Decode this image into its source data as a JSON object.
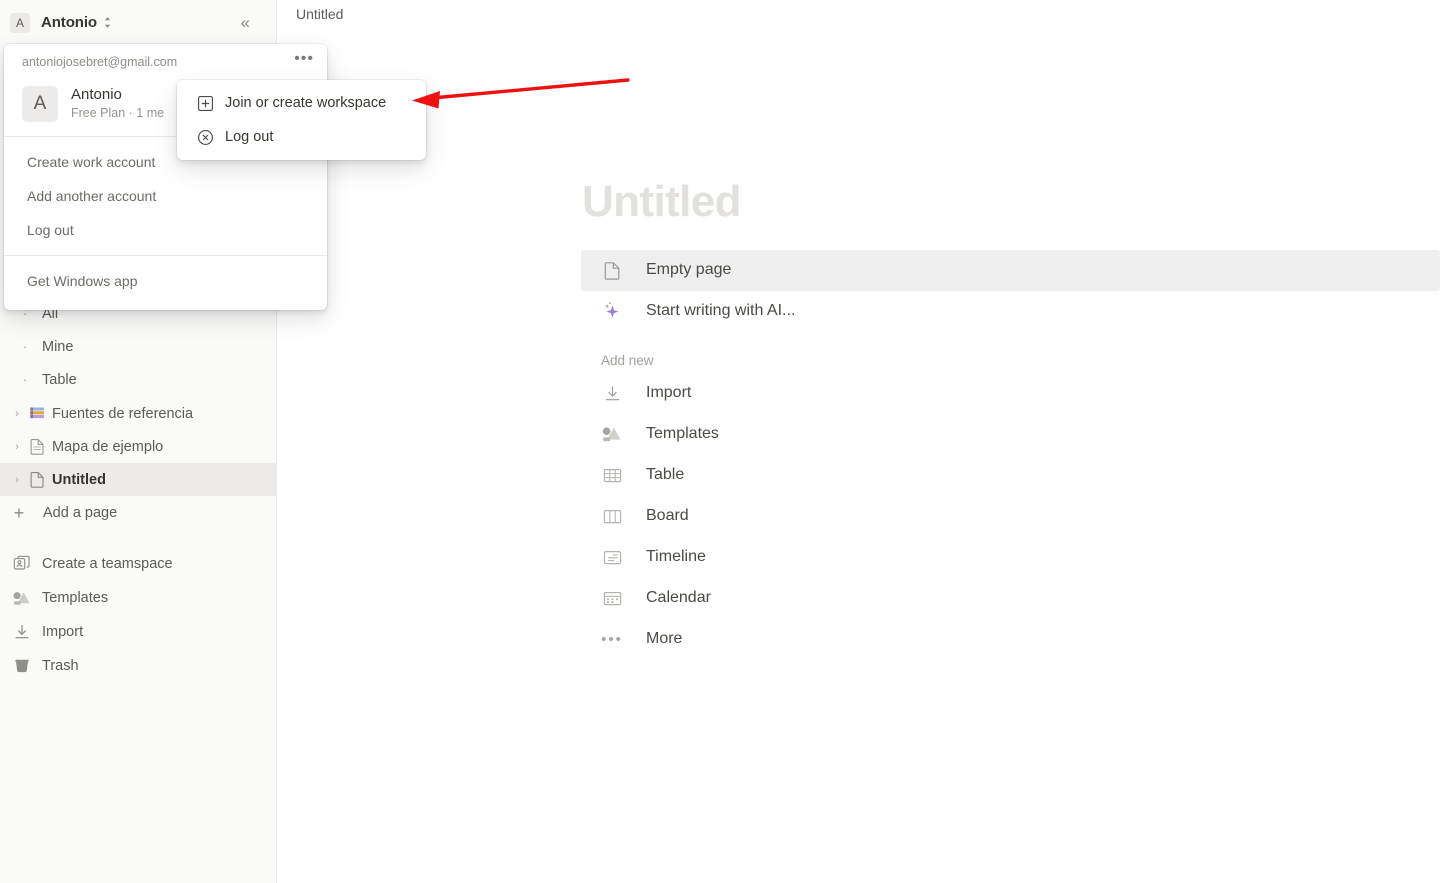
{
  "workspace": {
    "avatar_letter": "A",
    "name": "Antonio",
    "switch_icon": "chevron-up-down-icon",
    "collapse_icon": "collapse-sidebar-icon",
    "collapse_glyph": "«"
  },
  "breadcrumb": {
    "page": "Untitled"
  },
  "account_panel": {
    "email": "antoniojosebret@gmail.com",
    "more_icon": "ellipsis-icon",
    "more_glyph": "•••",
    "workspace": {
      "avatar_letter": "A",
      "name": "Antonio",
      "plan": "Free Plan · 1 me"
    },
    "items": [
      {
        "label": "Create work account"
      },
      {
        "label": "Add another account"
      },
      {
        "label": "Log out"
      }
    ],
    "footer_items": [
      {
        "label": "Get Windows app"
      }
    ]
  },
  "context_menu": {
    "items": [
      {
        "label": "Join or create workspace",
        "icon": "plus-square-icon"
      },
      {
        "label": "Log out",
        "icon": "x-circle-icon"
      }
    ]
  },
  "annotation": {
    "arrow_color": "#ee1111",
    "arrow_name": "red-pointer-arrow"
  },
  "sidebar": {
    "tree_items": [
      {
        "label": "All",
        "kind": "bullet",
        "icon": "bullet-dot-icon",
        "selected": false
      },
      {
        "label": "Mine",
        "kind": "bullet",
        "icon": "bullet-dot-icon",
        "selected": false
      },
      {
        "label": "Table",
        "kind": "bullet",
        "icon": "bullet-dot-icon",
        "selected": false
      }
    ],
    "page_items": [
      {
        "label": "Fuentes de referencia",
        "icon": "colored-books-emoji-icon",
        "selected": false
      },
      {
        "label": "Mapa de ejemplo",
        "icon": "page-icon",
        "selected": false
      },
      {
        "label": "Untitled",
        "icon": "page-icon",
        "selected": true
      }
    ],
    "add_page": {
      "label": "Add a page",
      "icon": "plus-icon"
    },
    "bottom_items": [
      {
        "label": "Create a teamspace",
        "icon": "teamspace-icon"
      },
      {
        "label": "Templates",
        "icon": "templates-icon"
      },
      {
        "label": "Import",
        "icon": "import-icon"
      },
      {
        "label": "Trash",
        "icon": "trash-icon"
      }
    ]
  },
  "main": {
    "title": "Untitled",
    "quick_options": [
      {
        "label": "Empty page",
        "icon": "page-icon",
        "highlighted": true
      },
      {
        "label": "Start writing with AI...",
        "icon": "ai-sparkle-icon",
        "highlighted": false
      }
    ],
    "add_new_label": "Add new",
    "add_new_items": [
      {
        "label": "Import",
        "icon": "import-icon"
      },
      {
        "label": "Templates",
        "icon": "templates-icon"
      },
      {
        "label": "Table",
        "icon": "table-icon"
      },
      {
        "label": "Board",
        "icon": "board-icon"
      },
      {
        "label": "Timeline",
        "icon": "timeline-icon"
      },
      {
        "label": "Calendar",
        "icon": "calendar-icon"
      },
      {
        "label": "More",
        "icon": "ellipsis-icon"
      }
    ]
  },
  "colors": {
    "sidebar_bg": "#fafaf9",
    "selected_row": "#ecebe9",
    "highlight_row": "#efefef",
    "title_placeholder": "#e2e1de",
    "ai_purple": "#9b7fd4",
    "annotation_red": "#ee1111"
  }
}
